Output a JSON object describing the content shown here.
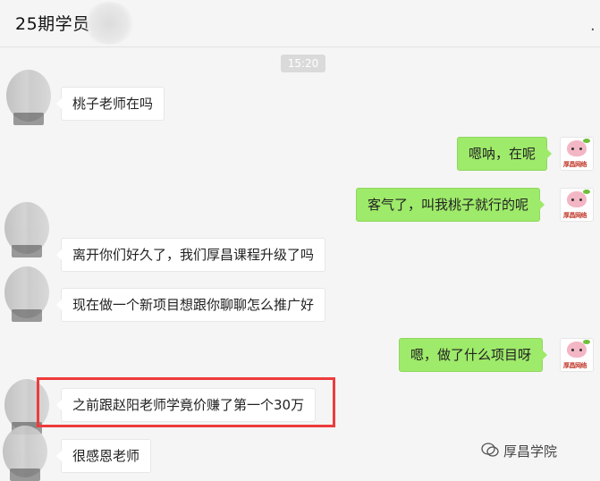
{
  "header": {
    "title": "25期学员",
    "more_label": "."
  },
  "time_badge": "15:20",
  "messages": [
    {
      "side": "left",
      "text": "桃子老师在吗"
    },
    {
      "side": "right",
      "text": "嗯呐，在呢"
    },
    {
      "side": "right",
      "text": "客气了，叫我桃子就行的呢"
    },
    {
      "side": "left",
      "text": "离开你们好久了，我们厚昌课程升级了吗"
    },
    {
      "side": "left",
      "text": "现在做一个新项目想跟你聊聊怎么推广好"
    },
    {
      "side": "right",
      "text": "嗯，做了什么项目呀"
    },
    {
      "side": "left",
      "text": "之前跟赵阳老师学竟价赚了第一个30万"
    },
    {
      "side": "left",
      "text": "很感恩老师"
    }
  ],
  "avatar_brand": "厚昌网络",
  "watermark": "厚昌学院",
  "colors": {
    "right_bubble": "#9eea6a",
    "left_bubble": "#ffffff",
    "highlight": "#ee3b3b",
    "background": "#f5f5f5"
  }
}
